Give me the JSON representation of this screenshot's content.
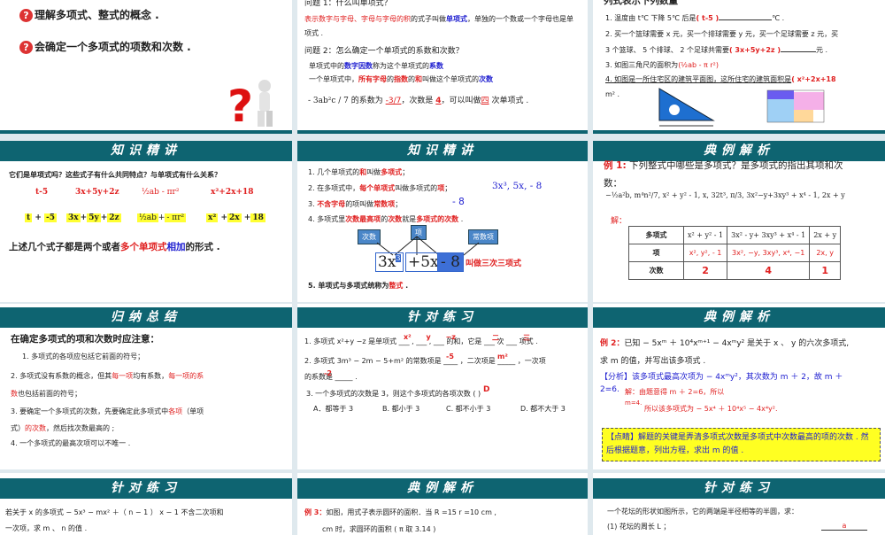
{
  "slides": {
    "goals": {
      "items": [
        "理解多项式、整式的概念 .",
        "会确定一个多项式的项数和次数 ."
      ]
    },
    "q1": {
      "q1": "问题 1：什么叫单项式？",
      "def_red": "表示数字与字母、字母与字母的积",
      "def_mid": "的式子叫做",
      "def_blue": "单项式",
      "def_tail": "，单独的一个数或一个字母也是单",
      "def_tail2": "项式 .",
      "q2": "问题 2：怎么确定一个单项式的系数和次数？",
      "c1a": "单项式中的",
      "c1b": "数字因数",
      "c1c": "称为这个单项式的",
      "c1d": "系数",
      "c2a": "一个单项式中，",
      "c2b": "所有字母",
      "c2c": "的",
      "c2d": "指数",
      "c2e": "的",
      "c2f": "和",
      "c2g": "叫做这个单项式的",
      "c2h": "次数",
      "ex_expr": "- 3ab²c / 7",
      "ex_a": "的系数为",
      "ex_coef": "-3/7",
      "ex_b": "，次数是",
      "ex_deg": "4",
      "ex_c": "，可以叫做",
      "ex_name": "四",
      "ex_d": "次单项式 ."
    },
    "list": {
      "title": "列式表示下列数量",
      "l1": "1. 温度由 t℃ 下降 5℃ 后是",
      "a1": "( t-5 )",
      "u1": "℃ .",
      "l2": "2. 买一个篮球需要 x 元，买一个排球需要 y 元，买一个足球需要 z 元，买",
      "l2b": "3 个篮球、 5 个排球、 2 个足球共需要",
      "a2": "( 3x+5y+2z )",
      "u2": "元 .",
      "l3": "3. 如图三角尺的面积为",
      "a3": "(½ab - π r²)",
      "l4": "4. 如图是一所住宅区的建筑平面图，这所住宅的建筑面积是",
      "a4": "( x²+2x+18",
      "u4": "m² ."
    },
    "k1": {
      "header": "知识精讲",
      "q": "它们是单项式吗？这些式子有什么共同特点？与单项式有什么关系？",
      "exprs": [
        "t-5",
        "3x+5y+2z",
        "½ab - πr²",
        "x²+2x+18"
      ],
      "split": [
        [
          "t",
          "-5"
        ],
        [
          "3x",
          "5y",
          "2z"
        ],
        [
          "½ab",
          "- πr²"
        ],
        [
          "x²",
          "2x",
          "18"
        ]
      ],
      "plus": "+",
      "concl_a": "上述几个式子都是两个或者",
      "concl_red": "多个单项式",
      "concl_blue": "相加",
      "concl_b": "的形式 ."
    },
    "k2": {
      "header": "知识精讲",
      "p1a": "1.  几个单项式的",
      "p1b": "和",
      "p1c": "叫做",
      "p1d": "多项式",
      "p1e": "；",
      "p2a": "2.  在多项式中，",
      "p2b": "每个单项式",
      "p2c": "叫做多项式的",
      "p2d": "项",
      "p2e": "；",
      "p2ex": "3x³, 5x, - 8",
      "p3a": "3.  ",
      "p3b": "不含字母",
      "p3c": "的项叫做",
      "p3d": "常数项",
      "p3e": "；",
      "p3ex": "- 8",
      "p4a": "4.  多项式里",
      "p4b": "次数最高项",
      "p4c": "的",
      "p4d": "次数",
      "p4e": "就是",
      "p4f": "多项式的次数",
      "p4g": " .",
      "lbl_deg": "次数",
      "lbl_term": "项",
      "lbl_const": "常数项",
      "t1": "3x",
      "t1e": "3",
      "t2": "+5x",
      "t3": "- 8",
      "name": "叫做三次三项式",
      "p5a": "5.  单项式与多项式统称为",
      "p5b": "整式",
      "p5c": " ."
    },
    "ex1": {
      "header": "典例解析",
      "label": "例 1:",
      "q": "下列整式中哪些是多项式？是多项式的指出其项和次",
      "q2": "数：",
      "list": "−½a²b,  m⁴n²/7,  x² + y² - 1,  x,  32t³,  π/3, 3x²−y+3xy³ + x⁴ - 1,  2x + y",
      "sol": "解：",
      "rows": [
        [
          "多项式",
          "x² + y² - 1",
          "3x² - y+ 3xy³ + x⁴ - 1",
          "2x + y"
        ],
        [
          "项",
          "x², y², - 1",
          "3x², −y, 3xy³, x⁴, −1",
          "2x, y"
        ],
        [
          "次数",
          "2",
          "4",
          "1"
        ]
      ]
    },
    "sum": {
      "header": "归纳总结",
      "title": "在确定多项式的项和次数时应注意：",
      "i1": "1. 多项式的各项应包括它前面的符号；",
      "i2a": "2.  多项式没有系数的概念，但其",
      "i2b": "每一项",
      "i2c": "均有系数，",
      "i2d": "每一项的系",
      "i2e": "数",
      "i2f": "也包括前面的符号；",
      "i3a": "3.  要确定一个多项式的次数，先要确定此多项式中",
      "i3b": "各项",
      "i3c": "（单项",
      "i3d": "式）",
      "i3e": "的次数",
      "i3f": "，然后找次数最高的 ;",
      "i4": "4.  一个多项式的最高次项可以不唯一 ."
    },
    "p1": {
      "header": "针对练习",
      "l1": "1. 多项式 x²+y −z 是单项式 ___ , ___ , ___ 的和，它是 ___ 次 ___ 项式 .",
      "a1": [
        "x²",
        "y",
        "−z",
        "二",
        "三"
      ],
      "l2": "2. 多项式 3m³ − 2m − 5+m² 的常数项是 ____ ，二次项是 _____ ，一次项",
      "a2": [
        "-5",
        "m²"
      ],
      "l2b": "的系数是 _____ .",
      "a2c": "-2",
      "l3": "3. 一个多项式的次数是 3，则这个多项式的各项次数 (      )",
      "a3": "D",
      "opts": [
        "A．都等于 3",
        "B. 都小于 3",
        "C. 都不小于 3",
        "D. 都不大于 3"
      ]
    },
    "ex2": {
      "header": "典例解析",
      "label": "例 2：",
      "q": "已知 − 5xᵐ ＋ 10⁴xᵐ⁺¹ − 4xᵐy² 是关于 x 、 y 的六次多项式,",
      "q2": "求 m 的值，并写出该多项式 .",
      "an": "【分析】该多项式最高次项为 − 4xᵐy²，其次数为 m ＋ 2，故 m ＋",
      "an2": "2=6.",
      "s1": "解：由题意得 m ＋ 2=6，所以",
      "s2a": "m=4.",
      "s2": "所以该多项式为 − 5x⁴ ＋ 10⁴x⁵ − 4x⁴y².",
      "tip": "【点睛】解题的关键是弄清多项式次数是多项式中次数最高的项的次数 . 然后根据题意，列出方程，求出 m 的值 ."
    },
    "p2": {
      "header": "针对练习",
      "l1": "若关于 x 的多项式 − 5x³ − mx² ＋（ n − 1 ） x − 1 不含二次项和",
      "l2": "一次项，求 m 、 n 的值 ."
    },
    "ex3": {
      "header": "典例解析",
      "label": "例 3：",
      "l1": "如图，用式子表示圆环的面积．当 R =15     r =10 cm ,",
      "l2": "cm 时，求圆环的面积 (   π 取 3.14   )"
    },
    "p3": {
      "header": "针对练习",
      "l1": "一个花坛的形状如图所示，它的两端是半径相等的半圆，求：",
      "l2": "(1) 花坛的周长 L ；",
      "fig": "a"
    }
  }
}
